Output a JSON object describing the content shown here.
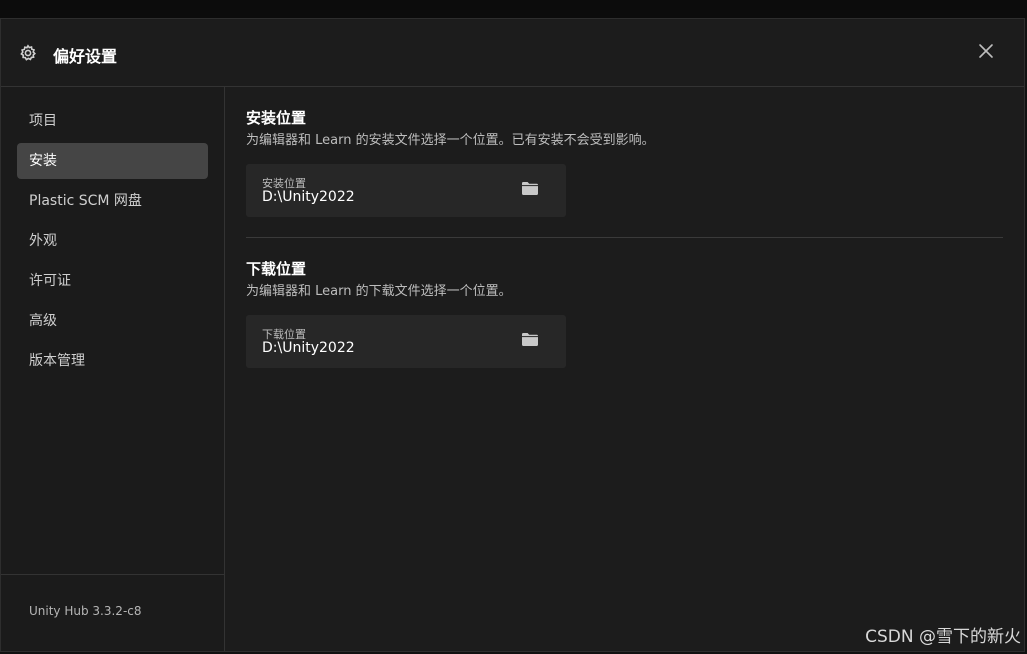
{
  "header": {
    "title": "偏好设置",
    "icon": "gear-icon",
    "close_icon": "close-icon"
  },
  "sidebar": {
    "items": [
      {
        "label": "项目",
        "active": false
      },
      {
        "label": "安装",
        "active": true
      },
      {
        "label": "Plastic SCM 网盘",
        "active": false
      },
      {
        "label": "外观",
        "active": false
      },
      {
        "label": "许可证",
        "active": false
      },
      {
        "label": "高级",
        "active": false
      },
      {
        "label": "版本管理",
        "active": false
      }
    ],
    "version": "Unity Hub 3.3.2-c8"
  },
  "install_section": {
    "title": "安装位置",
    "description": "为编辑器和 Learn 的安装文件选择一个位置。已有安装不会受到影响。",
    "field_label": "安装位置",
    "field_value": "D:\\Unity2022",
    "icon": "folder-icon"
  },
  "download_section": {
    "title": "下载位置",
    "description": "为编辑器和 Learn 的下载文件选择一个位置。",
    "field_label": "下载位置",
    "field_value": "D:\\Unity2022",
    "icon": "folder-icon"
  },
  "watermark": "CSDN @雪下的新火",
  "colors": {
    "background": "#1c1c1c",
    "active_item": "#454545",
    "field_bg": "#272727"
  }
}
